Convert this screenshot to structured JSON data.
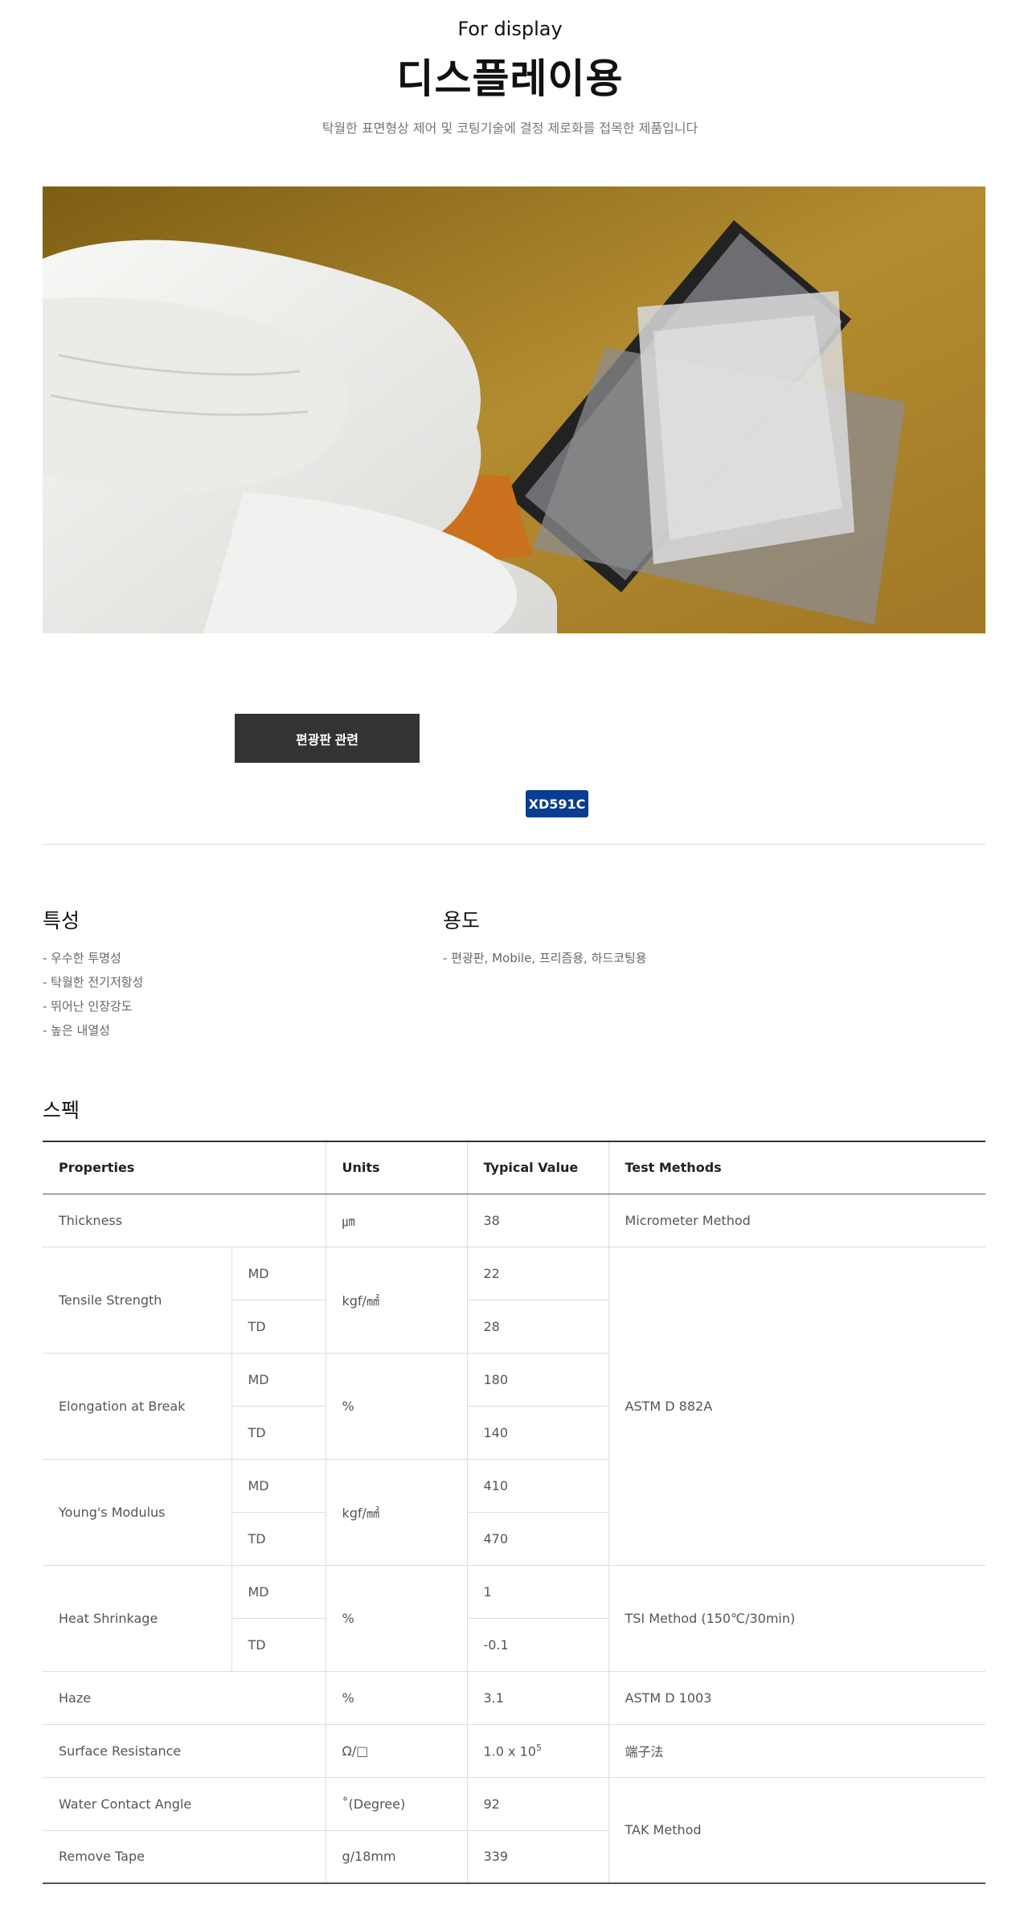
{
  "header": {
    "eyebrow": "For display",
    "title": "디스플레이용",
    "subtitle": "탁월한 표면형상 제어 및 코팅기술에 결정 제로화를 접목한 제품입니다"
  },
  "category_button": "편광판 관련",
  "product_badge": "XD591C",
  "features": {
    "title": "특성",
    "items": [
      "- 우수한 투명성",
      "- 탁월한 전기저항성",
      "- 뛰어난 인장강도",
      "- 높은 내열성"
    ]
  },
  "usage": {
    "title": "용도",
    "items": [
      "- 편광판, Mobile, 프리즘용, 하드코팅용"
    ]
  },
  "spec": {
    "title": "스펙",
    "headers": [
      "Properties",
      "Units",
      "Typical Value",
      "Test Methods"
    ],
    "rows": {
      "thickness": {
        "property": "Thickness",
        "unit": "㎛",
        "value": "38",
        "method": "Micrometer Method"
      },
      "tensile": {
        "property": "Tensile Strength",
        "md_label": "MD",
        "td_label": "TD",
        "unit": "kgf/㎟",
        "md_value": "22",
        "td_value": "28"
      },
      "elongation": {
        "property": "Elongation at Break",
        "md_label": "MD",
        "td_label": "TD",
        "unit": "%",
        "md_value": "180",
        "td_value": "140"
      },
      "youngs": {
        "property": "Young's Modulus",
        "md_label": "MD",
        "td_label": "TD",
        "unit": "kgf/㎟",
        "md_value": "410",
        "td_value": "470"
      },
      "astm_882": "ASTM D 882A",
      "shrink": {
        "property": "Heat Shrinkage",
        "md_label": "MD",
        "td_label": "TD",
        "unit": "%",
        "md_value": "1",
        "td_value": "-0.1",
        "method": "TSI Method (150℃/30min)"
      },
      "haze": {
        "property": "Haze",
        "unit": "%",
        "value": "3.1",
        "method": "ASTM D 1003"
      },
      "surface": {
        "property": "Surface Resistance",
        "unit": "Ω/□",
        "value_base": "1.0 x 10",
        "value_exp": "5",
        "method": "端子法"
      },
      "water": {
        "property": "Water Contact Angle",
        "unit": "˚(Degree)",
        "value": "92"
      },
      "tape": {
        "property": "Remove Tape",
        "unit": "g/18mm",
        "value": "339"
      },
      "tak": "TAK Method"
    }
  },
  "colors": {
    "button_bg": "#333333",
    "badge_bg": "#0a3d91",
    "photo_background": "#b08a2e"
  }
}
